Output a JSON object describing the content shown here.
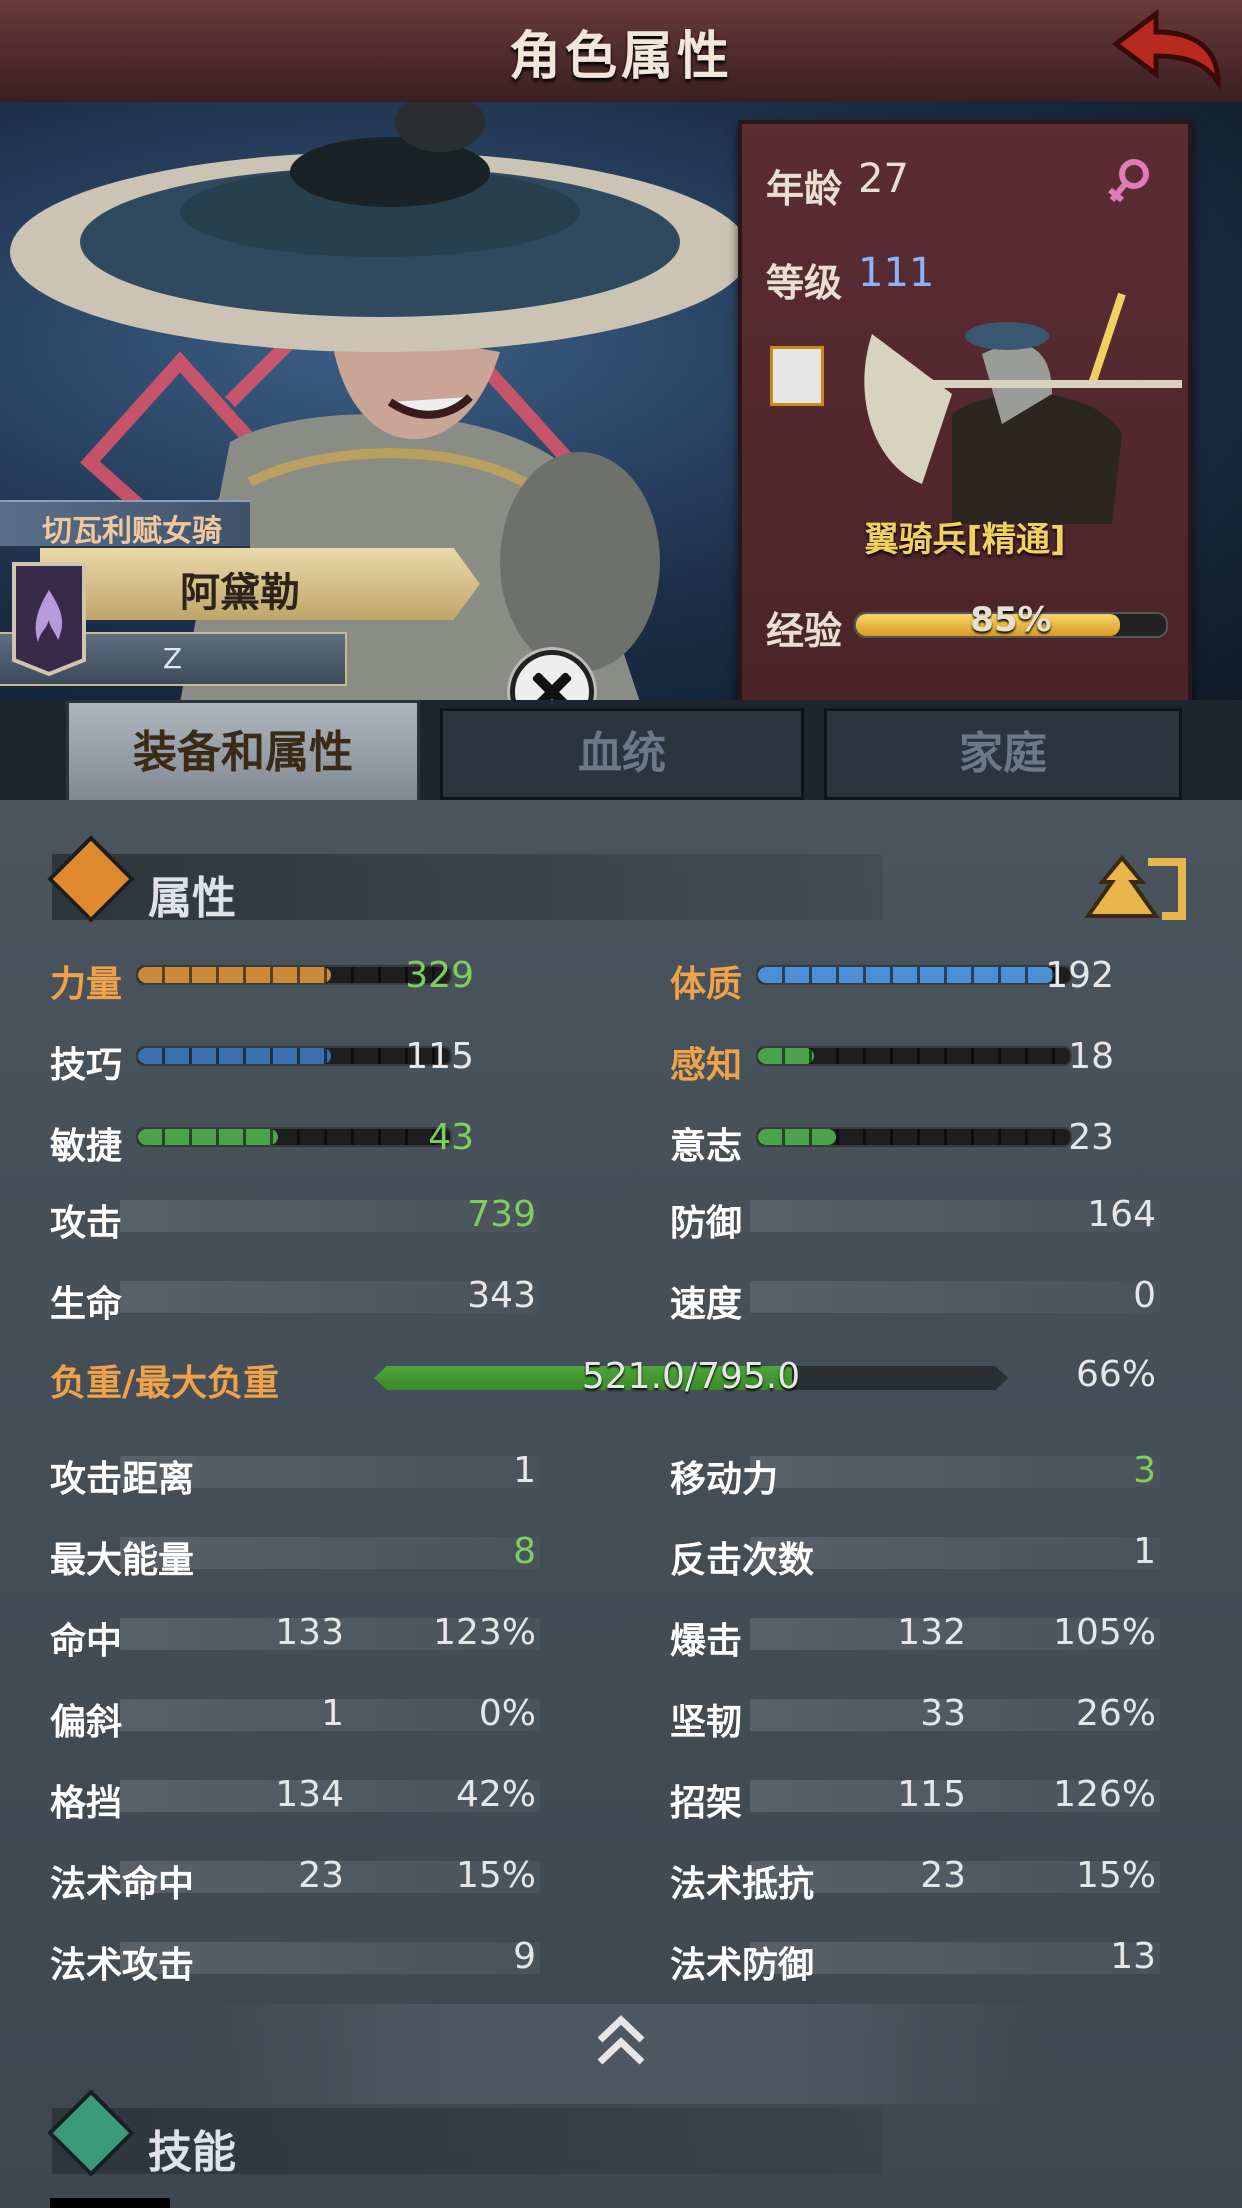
{
  "header": {
    "title": "角色属性"
  },
  "character": {
    "class_title": "切瓦利赋女骑士",
    "name": "阿黛勒",
    "subtitle": "Z",
    "age_label": "年龄",
    "age": "27",
    "level_label": "等级",
    "level": "111",
    "unit_name": "翼骑兵[精通]",
    "exp_label": "经验",
    "exp_text": "85%",
    "exp_value": 0.85
  },
  "tabs": [
    {
      "label": "装备和属性",
      "active": true
    },
    {
      "label": "血统",
      "active": false
    },
    {
      "label": "家庭",
      "active": false
    }
  ],
  "sections": {
    "attributes": "属性",
    "skills": "技能"
  },
  "primary_stats": [
    {
      "label": "力量",
      "value": "329",
      "fill": 0.62,
      "color": "#c98a3a",
      "label_color": "orange",
      "value_color": "green"
    },
    {
      "label": "体质",
      "value": "192",
      "fill": 0.95,
      "color": "#4c8fd4",
      "label_color": "orange",
      "value_color": "white"
    },
    {
      "label": "技巧",
      "value": "115",
      "fill": 0.62,
      "color": "#3a6fb0",
      "label_color": "white",
      "value_color": "white"
    },
    {
      "label": "感知",
      "value": "18",
      "fill": 0.18,
      "color": "#4aa24a",
      "label_color": "orange",
      "value_color": "white"
    },
    {
      "label": "敏捷",
      "value": "43",
      "fill": 0.45,
      "color": "#4aa24a",
      "label_color": "white",
      "value_color": "green"
    },
    {
      "label": "意志",
      "value": "23",
      "fill": 0.25,
      "color": "#4aa24a",
      "label_color": "white",
      "value_color": "white"
    }
  ],
  "secondary_stats_top": [
    {
      "label": "攻击",
      "value": "739",
      "value_color": "green"
    },
    {
      "label": "防御",
      "value": "164",
      "value_color": "white"
    },
    {
      "label": "生命",
      "value": "343",
      "value_color": "white"
    },
    {
      "label": "速度",
      "value": "0",
      "value_color": "white"
    }
  ],
  "load": {
    "label": "负重/最大负重",
    "text": "521.0/795.0",
    "percent_text": "66%",
    "fill": 0.66
  },
  "secondary_stats_bottom": [
    {
      "label": "攻击距离",
      "value": "1",
      "value_color": "white"
    },
    {
      "label": "移动力",
      "value": "3",
      "value_color": "green"
    },
    {
      "label": "最大能量",
      "value": "8",
      "value_color": "green"
    },
    {
      "label": "反击次数",
      "value": "1",
      "value_color": "white"
    }
  ],
  "combat_stats": [
    {
      "label": "命中",
      "value": "133",
      "percent": "123%"
    },
    {
      "label": "爆击",
      "value": "132",
      "percent": "105%"
    },
    {
      "label": "偏斜",
      "value": "1",
      "percent": "0%"
    },
    {
      "label": "坚韧",
      "value": "33",
      "percent": "26%"
    },
    {
      "label": "格挡",
      "value": "134",
      "percent": "42%"
    },
    {
      "label": "招架",
      "value": "115",
      "percent": "126%"
    },
    {
      "label": "法术命中",
      "value": "23",
      "percent": "15%"
    },
    {
      "label": "法术抵抗",
      "value": "23",
      "percent": "15%"
    }
  ],
  "magic_stats": [
    {
      "label": "法术攻击",
      "value": "9"
    },
    {
      "label": "法术防御",
      "value": "13"
    }
  ],
  "icons": {
    "back": "back-arrow-icon",
    "gender": "female-icon",
    "close": "close-icon",
    "rank": "rank-badge-icon",
    "sort": "sort-icon",
    "collapse": "chevron-up-icon",
    "attributes": "attribute-icon",
    "skills": "skill-icon"
  },
  "colors": {
    "accent_orange": "#f0a24a",
    "value_green": "#7ed05a",
    "level_blue": "#8ab4ff",
    "gender_pink": "#e07ab8"
  }
}
